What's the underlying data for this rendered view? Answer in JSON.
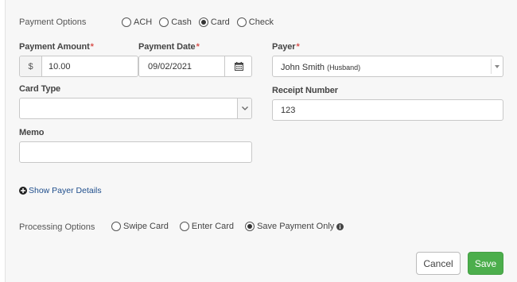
{
  "payment_options": {
    "label": "Payment Options",
    "options": [
      {
        "label": "ACH",
        "selected": false
      },
      {
        "label": "Cash",
        "selected": false
      },
      {
        "label": "Card",
        "selected": true
      },
      {
        "label": "Check",
        "selected": false
      }
    ]
  },
  "payment_amount": {
    "label": "Payment Amount",
    "currency": "$",
    "value": "10.00"
  },
  "payment_date": {
    "label": "Payment Date",
    "value": "09/02/2021"
  },
  "payer": {
    "label": "Payer",
    "name": "John Smith",
    "relation": "(Husband)"
  },
  "card_type": {
    "label": "Card Type",
    "value": ""
  },
  "receipt_number": {
    "label": "Receipt Number",
    "value": "123"
  },
  "memo": {
    "label": "Memo",
    "value": ""
  },
  "show_payer_details": "Show Payer Details",
  "processing_options": {
    "label": "Processing Options",
    "options": [
      {
        "label": "Swipe Card",
        "selected": false
      },
      {
        "label": "Enter Card",
        "selected": false
      },
      {
        "label": "Save Payment Only",
        "selected": true
      }
    ]
  },
  "buttons": {
    "cancel": "Cancel",
    "save": "Save"
  },
  "required_marker": "*",
  "colors": {
    "accent_green": "#4cae4c",
    "required_red": "#d9534f"
  }
}
